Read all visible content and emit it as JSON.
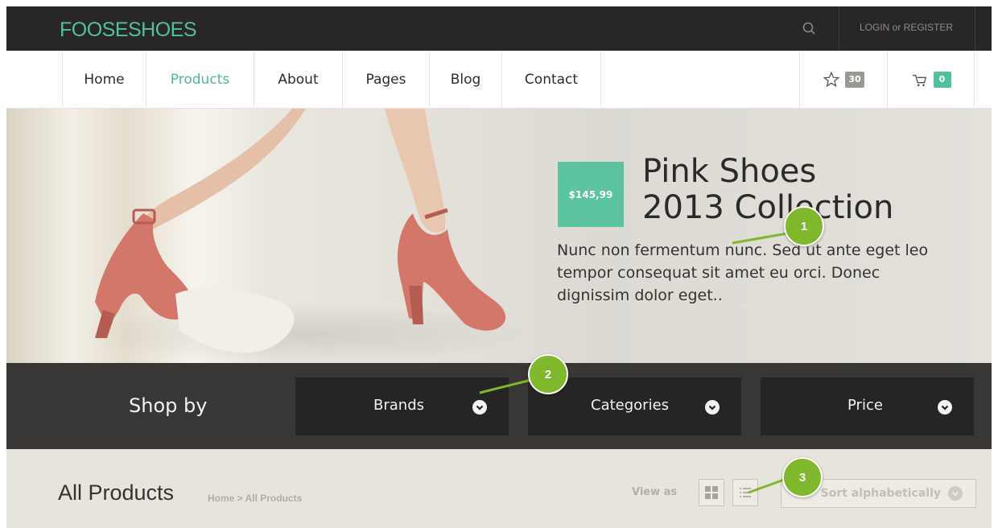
{
  "header": {
    "logo": "FOOSESHOES",
    "auth_text": "LOGIN or REGISTER"
  },
  "nav": {
    "items": [
      {
        "label": "Home",
        "active": false
      },
      {
        "label": "Products",
        "active": true
      },
      {
        "label": "About",
        "active": false
      },
      {
        "label": "Pages",
        "active": false
      },
      {
        "label": "Blog",
        "active": false
      },
      {
        "label": "Contact",
        "active": false
      }
    ],
    "wishlist_count": "30",
    "cart_count": "0"
  },
  "hero": {
    "price": "$145,99",
    "title_line1": "Pink Shoes",
    "title_line2": "2013 Collection",
    "text": "Nunc non fermentum nunc. Sed ut ante eget leo tempor consequat sit amet eu orci. Donec dignissim dolor eget.."
  },
  "shop_by": {
    "label": "Shop by",
    "filters": [
      "Brands",
      "Categories",
      "Price"
    ]
  },
  "products": {
    "title": "All Products",
    "breadcrumb": "Home > All Products",
    "view_as": "View as",
    "sort_label": "Sort alphabetically"
  },
  "callouts": [
    "1",
    "2",
    "3"
  ],
  "colors": {
    "accent": "#4fc1a0",
    "topbar": "#282626",
    "shopbar": "#393636",
    "callout": "#7fb82c"
  }
}
